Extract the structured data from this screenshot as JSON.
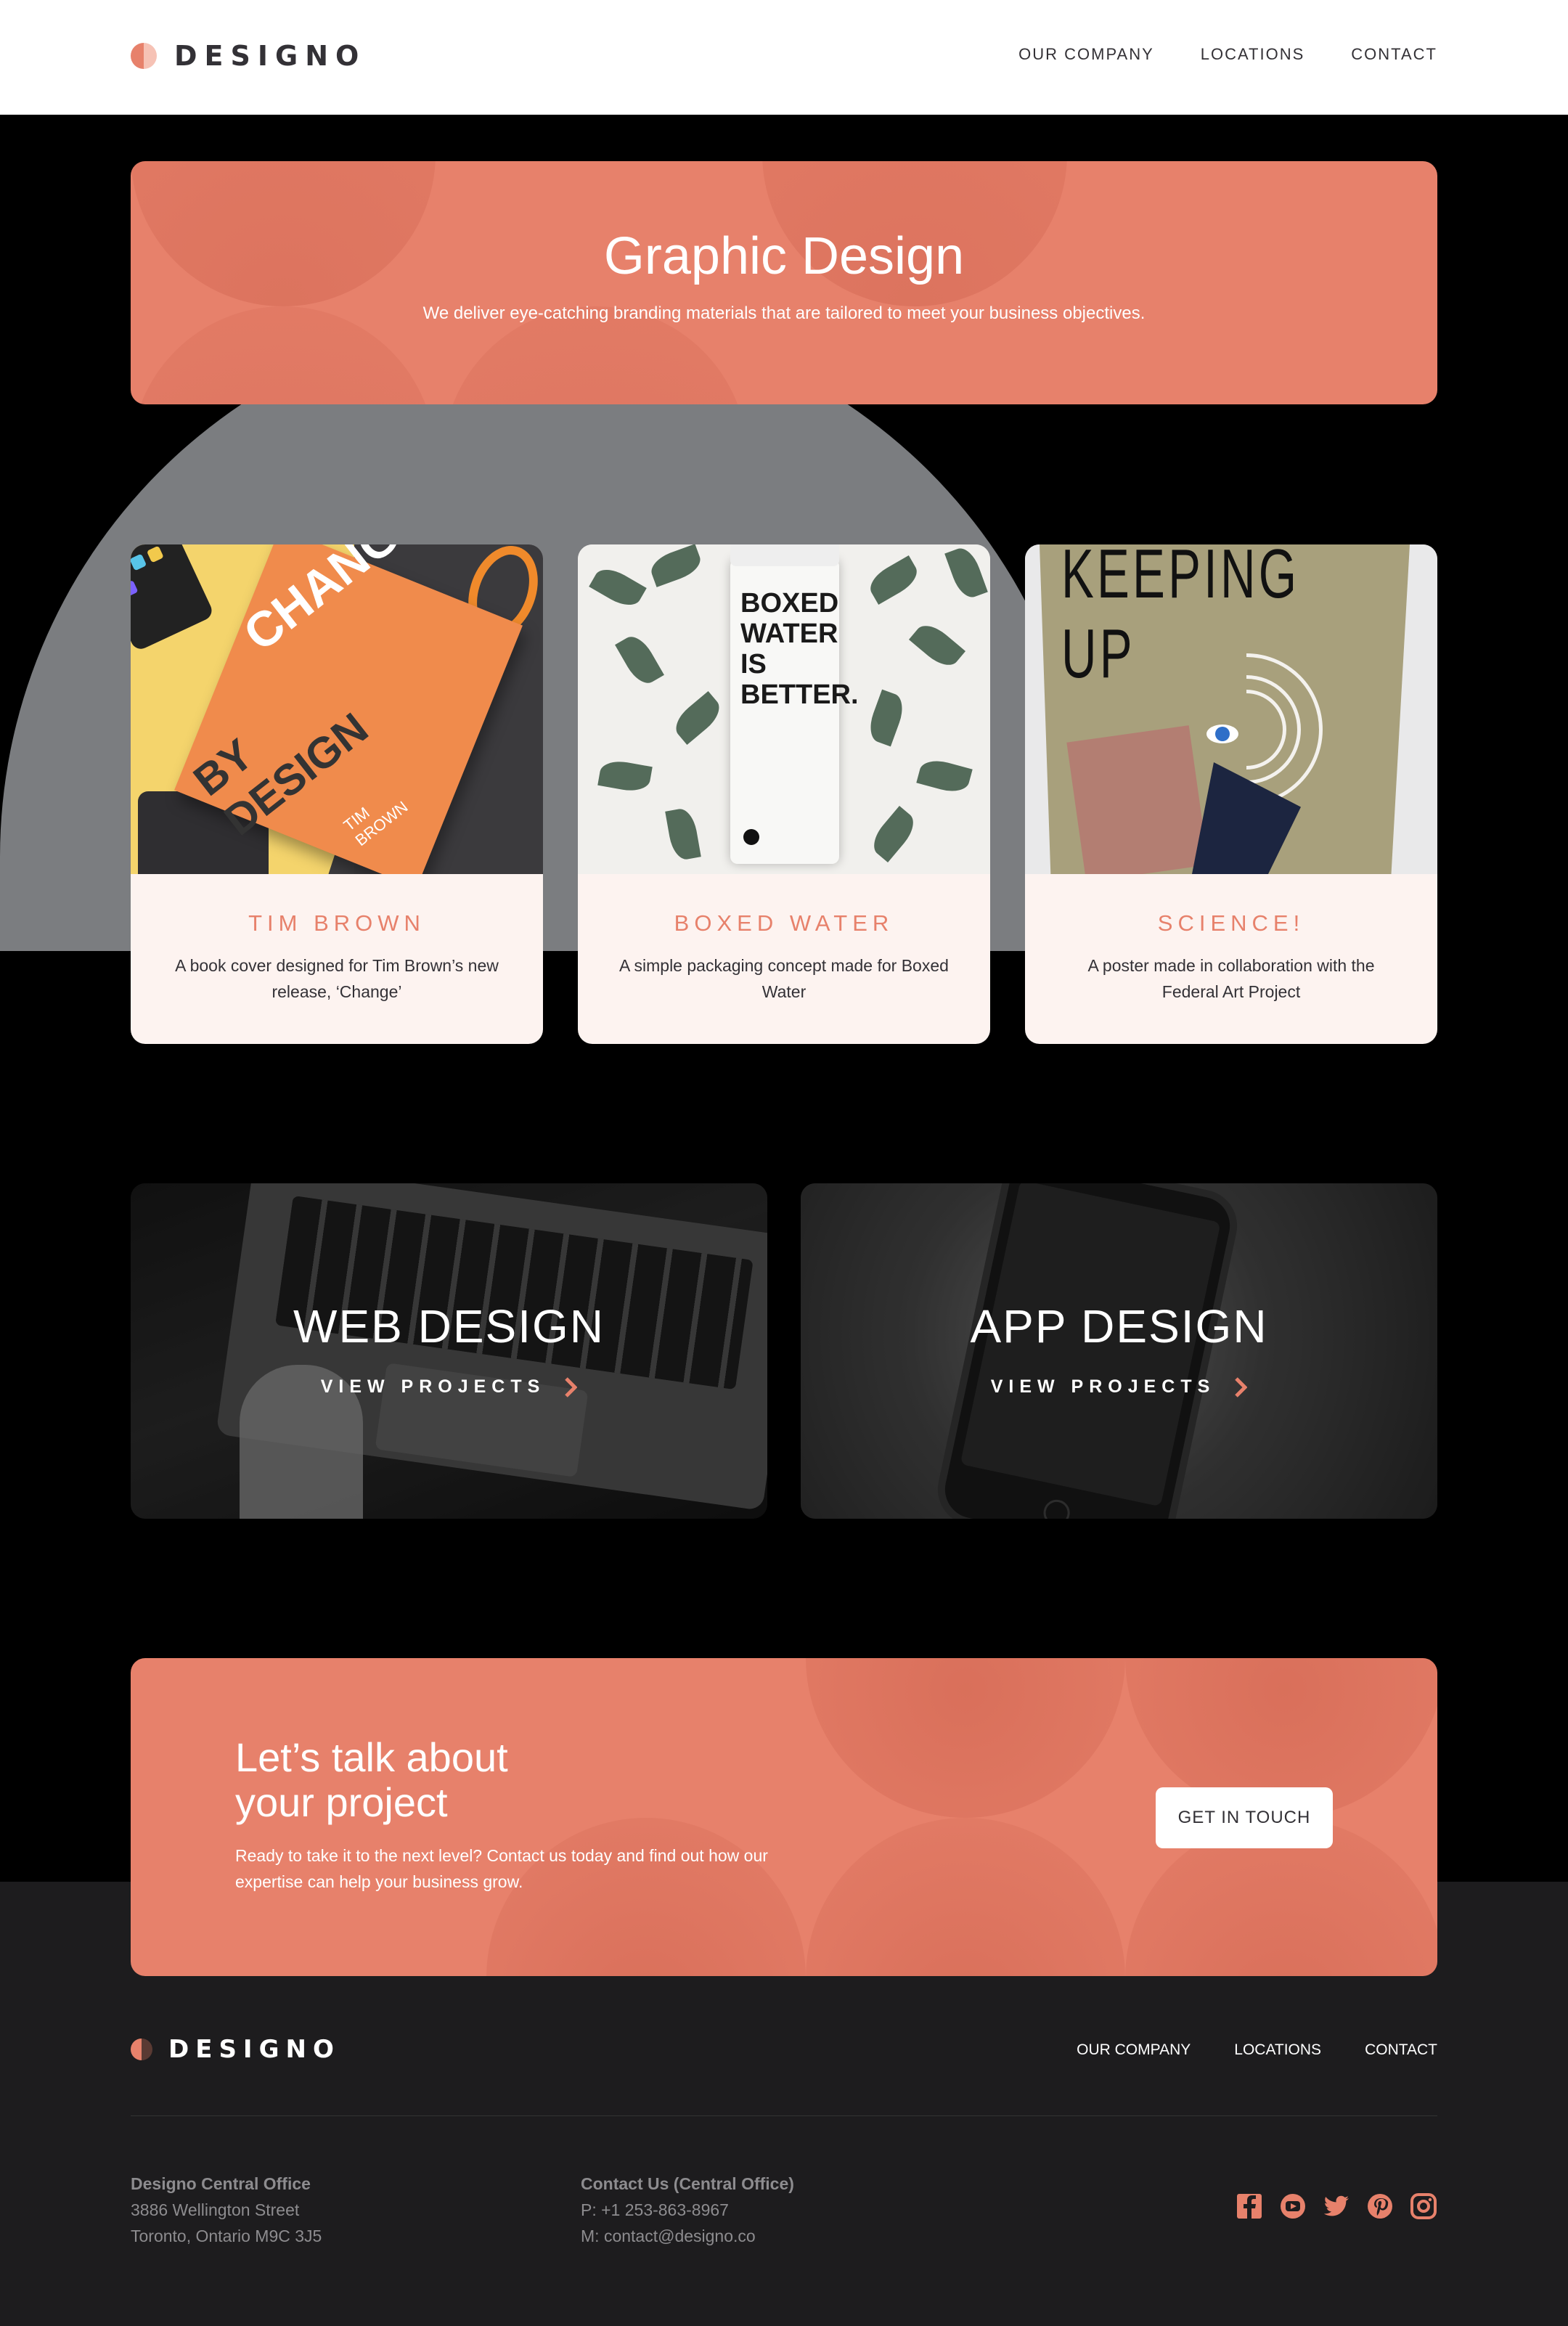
{
  "brand": {
    "name": "DESIGNO",
    "accent": "#E7816B",
    "accent_light": "#FDF3F0",
    "dark": "#1d1c1e"
  },
  "header": {
    "nav": [
      "OUR COMPANY",
      "LOCATIONS",
      "CONTACT"
    ]
  },
  "hero": {
    "title": "Graphic Design",
    "subtitle": "We deliver eye-catching branding materials that are tailored to meet your business objectives."
  },
  "projects": [
    {
      "title": "TIM BROWN",
      "description": "A book cover designed for Tim Brown’s new release, ‘Change’",
      "image_text": [
        "CHANGE",
        "BY DESIGN",
        "TIM BROWN"
      ]
    },
    {
      "title": "BOXED WATER",
      "description": "A simple packaging concept made for Boxed Water",
      "image_text": "BOXED WATER IS BETTER."
    },
    {
      "title": "SCIENCE!",
      "description": "A poster made in collaboration with the Federal Art Project",
      "image_text": "KEEPING UP"
    }
  ],
  "categories": [
    {
      "title": "WEB DESIGN",
      "link": "VIEW PROJECTS"
    },
    {
      "title": "APP DESIGN",
      "link": "VIEW PROJECTS"
    }
  ],
  "cta": {
    "title": "Let’s talk about your project",
    "text": "Ready to take it to the next level? Contact us today and find out how our expertise can help your business grow.",
    "button": "GET IN TOUCH"
  },
  "footer": {
    "nav": [
      "OUR COMPANY",
      "LOCATIONS",
      "CONTACT"
    ],
    "office": {
      "heading": "Designo Central Office",
      "line1": "3886 Wellington Street",
      "line2": "Toronto, Ontario M9C 3J5"
    },
    "contact": {
      "heading": "Contact Us (Central Office)",
      "phone": "P: +1 253-863-8967",
      "email": "M: contact@designo.co"
    },
    "socials": [
      "facebook-icon",
      "youtube-icon",
      "twitter-icon",
      "pinterest-icon",
      "instagram-icon"
    ]
  }
}
